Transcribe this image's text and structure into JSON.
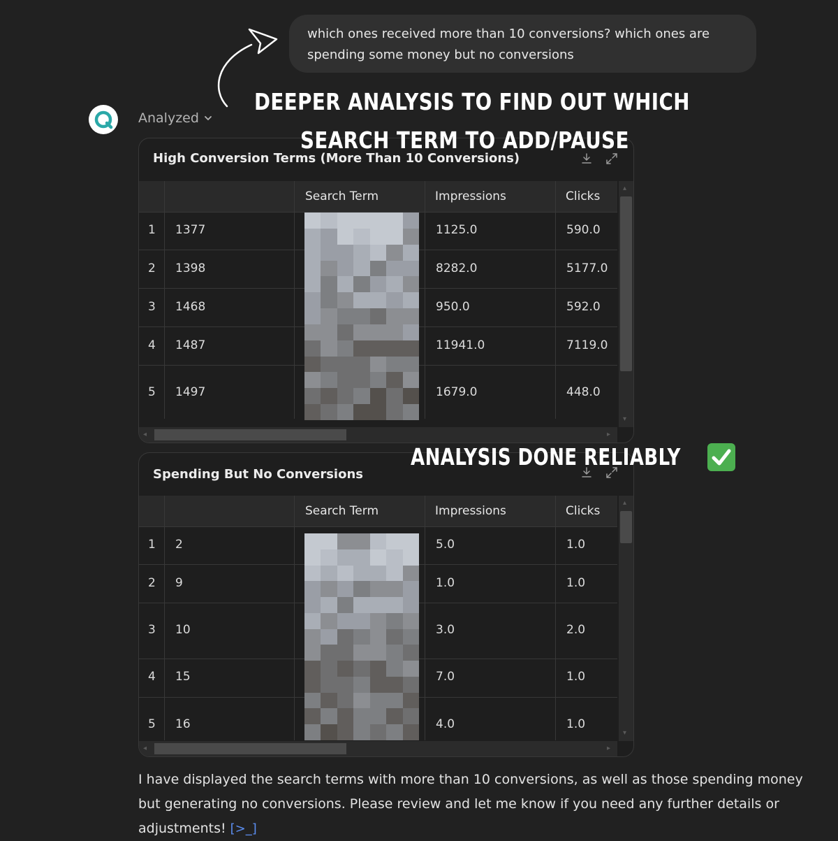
{
  "user_message": {
    "line1": "which ones received more than 10 conversions? which ones are",
    "line2": "spending some money but no conversions"
  },
  "assistant": {
    "status_label": "Analyzed"
  },
  "annotations": {
    "line1": "DEEPER ANALYSIS TO FIND OUT WHICH",
    "line2": "SEARCH TERM TO ADD/PAUSE",
    "line3": "ANALYSIS DONE RELIABLY"
  },
  "table1": {
    "title": "High Conversion Terms (More Than 10 Conversions)",
    "columns": [
      "",
      "Search Term",
      "Impressions",
      "Clicks"
    ],
    "rows": [
      {
        "n": "1",
        "id": "1377",
        "impressions": "1125.0",
        "clicks": "590.0"
      },
      {
        "n": "2",
        "id": "1398",
        "impressions": "8282.0",
        "clicks": "5177.0"
      },
      {
        "n": "3",
        "id": "1468",
        "impressions": "950.0",
        "clicks": "592.0"
      },
      {
        "n": "4",
        "id": "1487",
        "impressions": "11941.0",
        "clicks": "7119.0"
      },
      {
        "n": "5",
        "id": "1497",
        "impressions": "1679.0",
        "clicks": "448.0"
      }
    ]
  },
  "table2": {
    "title": "Spending But No Conversions",
    "columns": [
      "",
      "Search Term",
      "Impressions",
      "Clicks"
    ],
    "rows": [
      {
        "n": "1",
        "id": "2",
        "impressions": "5.0",
        "clicks": "1.0"
      },
      {
        "n": "2",
        "id": "9",
        "impressions": "1.0",
        "clicks": "1.0"
      },
      {
        "n": "3",
        "id": "10",
        "impressions": "3.0",
        "clicks": "2.0"
      },
      {
        "n": "4",
        "id": "15",
        "impressions": "7.0",
        "clicks": "1.0"
      },
      {
        "n": "5",
        "id": "16",
        "impressions": "4.0",
        "clicks": "1.0"
      }
    ]
  },
  "summary": {
    "line1": "I have displayed the search terms with more than 10 conversions, as well as those spending money",
    "line2": "but generating no conversions. Please review and let me know if you need any further details or",
    "line3": "adjustments!"
  },
  "colors": {
    "background": "#212121",
    "bubble": "#303030",
    "avatar_accent": "#2aa8a8",
    "code_icon": "#5b8def",
    "check": "#4caf50"
  },
  "icons": {
    "avatar": "search-magnifier-logo",
    "chevron": "chevron-down-icon",
    "download": "download-icon",
    "expand": "expand-icon",
    "code": "code-icon",
    "check": "check-mark-icon"
  }
}
